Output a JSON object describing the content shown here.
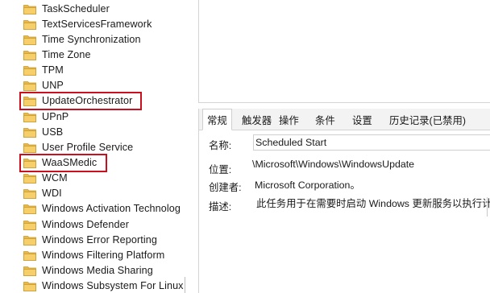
{
  "tree": {
    "items": [
      {
        "label": "TaskScheduler"
      },
      {
        "label": "TextServicesFramework"
      },
      {
        "label": "Time Synchronization"
      },
      {
        "label": "Time Zone"
      },
      {
        "label": "TPM"
      },
      {
        "label": "UNP"
      },
      {
        "label": "UpdateOrchestrator",
        "highlighted": true
      },
      {
        "label": "UPnP"
      },
      {
        "label": "USB"
      },
      {
        "label": "User Profile Service"
      },
      {
        "label": "WaaSMedic",
        "highlighted": true
      },
      {
        "label": "WCM"
      },
      {
        "label": "WDI"
      },
      {
        "label": "Windows Activation Technolog"
      },
      {
        "label": "Windows Defender"
      },
      {
        "label": "Windows Error Reporting"
      },
      {
        "label": "Windows Filtering Platform"
      },
      {
        "label": "Windows Media Sharing"
      },
      {
        "label": "Windows Subsystem For Linux"
      }
    ],
    "folder_color": "#e8b84a",
    "highlight_color": "#c8101e"
  },
  "details": {
    "tabs": [
      {
        "label": "常规",
        "active": true
      },
      {
        "label": "触发器"
      },
      {
        "label": "操作"
      },
      {
        "label": "条件"
      },
      {
        "label": "设置"
      },
      {
        "label": "历史记录(已禁用)"
      }
    ],
    "fields": {
      "name_label": "名称:",
      "name_value": "Scheduled Start",
      "location_label": "位置:",
      "location_value": "\\Microsoft\\Windows\\WindowsUpdate",
      "author_label": "创建者:",
      "author_value": "Microsoft Corporation。",
      "description_label": "描述:",
      "description_value": "此任务用于在需要时启动 Windows 更新服务以执行计划的"
    }
  }
}
